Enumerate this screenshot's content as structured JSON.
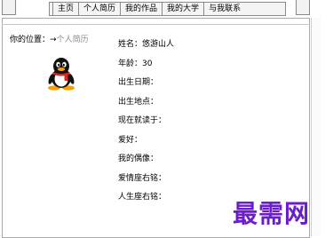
{
  "nav": {
    "items": [
      {
        "label": "主页"
      },
      {
        "label": "个人简历"
      },
      {
        "label": "我的作品"
      },
      {
        "label": "我的大学"
      },
      {
        "label": "与我联系"
      }
    ]
  },
  "breadcrumb": {
    "prefix": "你的位置：",
    "arrow": "→",
    "current": "个人简历"
  },
  "profile": {
    "avatar_icon": "qq-penguin-icon",
    "fields": [
      {
        "label": "姓名：",
        "value": "悠游山人"
      },
      {
        "label": "年龄：",
        "value": "30"
      },
      {
        "label": "出生日期：",
        "value": ""
      },
      {
        "label": "出生地点：",
        "value": ""
      },
      {
        "label": "现在就读于：",
        "value": ""
      },
      {
        "label": "爱好：",
        "value": ""
      },
      {
        "label": "我的偶像：",
        "value": ""
      },
      {
        "label": "爱情座右铭：",
        "value": ""
      },
      {
        "label": "人生座右铭：",
        "value": ""
      }
    ]
  },
  "watermark": {
    "text": "最需网",
    "color": "#6b1fc8"
  }
}
